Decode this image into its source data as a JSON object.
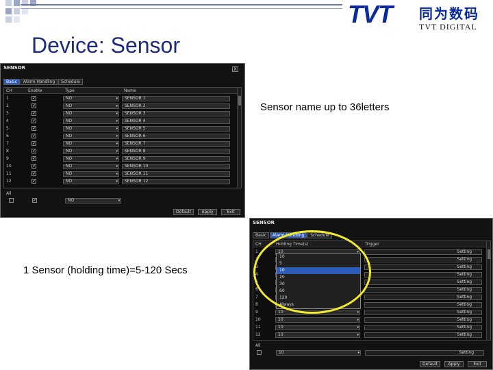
{
  "slide": {
    "title": "Device: Sensor",
    "note_name": "Sensor name up to 36letters",
    "note_holding": "1 Sensor (holding time)=5-120 Secs"
  },
  "logo": {
    "main": "TVT",
    "chinese": "同为数码",
    "sub": "TVT DIGITAL"
  },
  "colors": {
    "title": "#1d2a7a",
    "logo": "#0a2a9c",
    "highlight": "#f2ea2a",
    "active_tab": "#2d5bb8"
  },
  "dialog1": {
    "title": "SENSOR",
    "close": "X",
    "tabs": [
      "Basic",
      "Alarm Handling",
      "Schedule"
    ],
    "active_tab": 0,
    "columns": [
      "CH",
      "Enable",
      "Type",
      "Name"
    ],
    "rows": [
      {
        "ch": "1",
        "type": "NO",
        "name": "SENSOR 1"
      },
      {
        "ch": "2",
        "type": "NO",
        "name": "SENSOR 2"
      },
      {
        "ch": "3",
        "type": "NO",
        "name": "SENSOR 3"
      },
      {
        "ch": "4",
        "type": "NO",
        "name": "SENSOR 4"
      },
      {
        "ch": "5",
        "type": "NO",
        "name": "SENSOR 5"
      },
      {
        "ch": "6",
        "type": "NO",
        "name": "SENSOR 6"
      },
      {
        "ch": "7",
        "type": "NO",
        "name": "SENSOR 7"
      },
      {
        "ch": "8",
        "type": "NO",
        "name": "SENSOR 8"
      },
      {
        "ch": "9",
        "type": "NO",
        "name": "SENSOR 9"
      },
      {
        "ch": "10",
        "type": "NO",
        "name": "SENSOR 10"
      },
      {
        "ch": "11",
        "type": "NO",
        "name": "SENSOR 11"
      },
      {
        "ch": "12",
        "type": "NO",
        "name": "SENSOR 12"
      }
    ],
    "all_label": "All",
    "all_type": "NO",
    "buttons": [
      "Default",
      "Apply",
      "Exit"
    ]
  },
  "dialog2": {
    "title": "SENSOR",
    "tabs": [
      "Basic",
      "Alarm Handling",
      "Schedule"
    ],
    "active_tab": 1,
    "columns": [
      "CH",
      "Holding Time(s)",
      "Trigger"
    ],
    "setting_label": "Setting",
    "rows": [
      {
        "ch": "1",
        "holding": "10"
      },
      {
        "ch": "2",
        "holding": "10"
      },
      {
        "ch": "3",
        "holding": "10"
      },
      {
        "ch": "4",
        "holding": "10"
      },
      {
        "ch": "5",
        "holding": "10"
      },
      {
        "ch": "6",
        "holding": "10"
      },
      {
        "ch": "7",
        "holding": "10"
      },
      {
        "ch": "8",
        "holding": "10"
      },
      {
        "ch": "9",
        "holding": "10"
      },
      {
        "ch": "10",
        "holding": "10"
      },
      {
        "ch": "11",
        "holding": "10"
      },
      {
        "ch": "12",
        "holding": "10"
      }
    ],
    "dropdown_options": [
      "10",
      "5",
      "10",
      "20",
      "30",
      "60",
      "120",
      "Always"
    ],
    "dropdown_selected": 2,
    "all_label": "All",
    "all_holding": "10",
    "buttons": [
      "Default",
      "Apply",
      "Exit"
    ]
  }
}
